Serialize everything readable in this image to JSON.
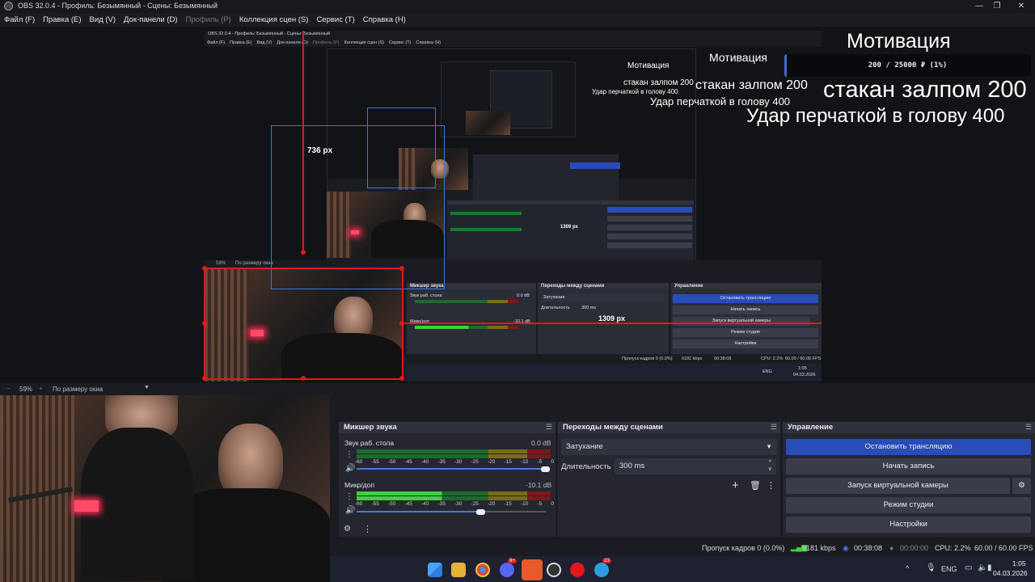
{
  "window": {
    "title": "OBS 32.0.4 - Профиль: Безымянный - Сцены: Безымянный",
    "minimize": "—",
    "maximize": "❐",
    "close": "✕"
  },
  "menu": [
    {
      "label": "Файл (F)",
      "disabled": false
    },
    {
      "label": "Правка (E)",
      "disabled": false
    },
    {
      "label": "Вид (V)",
      "disabled": false
    },
    {
      "label": "Док-панели (D)",
      "disabled": false
    },
    {
      "label": "Профиль (P)",
      "disabled": true
    },
    {
      "label": "Коллекция сцен (S)",
      "disabled": false
    },
    {
      "label": "Сервис (T)",
      "disabled": false
    },
    {
      "label": "Справка (H)",
      "disabled": false
    }
  ],
  "overlay": {
    "motivation_title": "Мотивация",
    "progress_text": "200 / 25000 ₽ (1%)",
    "progress_percent": 1,
    "line1": "стакан залпом 200",
    "line2": "Удар перчаткой в голову 400"
  },
  "measure": {
    "height_label": "736 px",
    "width_label": "1309 px"
  },
  "nested": {
    "title": "OBS 32.0.4 - Профиль: Безымянный - Сцены: Безымянный",
    "menu": [
      "Файл (F)",
      "Правка (E)",
      "Вид (V)",
      "Док-панели (D)",
      "Профиль (P)",
      "Коллекция сцен (S)",
      "Сервис (T)",
      "Справка (H)"
    ],
    "zoom": "59%",
    "zoom_mode": "По размеру окна",
    "mixer_title": "Микшер звука",
    "track1": "Звук раб. стола",
    "track1_db": "0.0 dB",
    "track2": "Микр/доп",
    "track2_db": "-10.1 dB",
    "transitions_title": "Переходы между сценами",
    "fade": "Затухание",
    "duration_label": "Длительность",
    "duration_value": "300 ms",
    "controls_title": "Управление",
    "stop_stream": "Остановить трансляцию",
    "start_record": "Начать запись",
    "virtual_cam": "Запуск виртуальной камеры",
    "studio_mode": "Режим студии",
    "settings": "Настройки",
    "status": "Пропуск кадров 0 (0.0%)",
    "kbps": "6181 kbps",
    "time": "00:38:08",
    "cpu": "CPU: 2.2%",
    "fps": "60.00 / 60.00 FPS",
    "clock": "1:05",
    "date": "04.03.2026",
    "lang": "ENG"
  },
  "zoombar": {
    "zoom": "59%",
    "mode": "По размеру окна"
  },
  "mixer": {
    "title": "Микшер звука",
    "scale": [
      "-60",
      "-55",
      "-50",
      "-45",
      "-40",
      "-35",
      "-30",
      "-25",
      "-20",
      "-15",
      "-10",
      "-5",
      "0"
    ],
    "tracks": [
      {
        "name": "Звук раб. стола",
        "db": "0.0 dB",
        "level": 0,
        "volume": 1.0
      },
      {
        "name": "Микр/доп",
        "db": "-10.1 dB",
        "level": 0.55,
        "volume": 0.65
      }
    ]
  },
  "transitions": {
    "title": "Переходы между сценами",
    "selected": "Затухание",
    "duration_label": "Длительность",
    "duration_value": "300 ms"
  },
  "controls": {
    "title": "Управление",
    "stop_stream": "Остановить трансляцию",
    "start_record": "Начать запись",
    "virtual_camera": "Запуск виртуальной камеры",
    "studio_mode": "Режим студии",
    "settings": "Настройки"
  },
  "status": {
    "dropped": "Пропуск кадров 0 (0.0%)",
    "bitrate": "6181 kbps",
    "stream_time": "00:38:08",
    "record_time": "00:00:00",
    "cpu": "CPU: 2.2%",
    "fps": "60.00 / 60.00 FPS"
  },
  "taskbar": {
    "lang": "ENG",
    "time": "1:05",
    "date": "04.03.2026",
    "discord_badge": "9+",
    "telegram_badge": "23"
  },
  "colors": {
    "accent_blue": "#284cb8",
    "measure_red": "#e0191c",
    "measure_blue": "#3a78e0"
  }
}
